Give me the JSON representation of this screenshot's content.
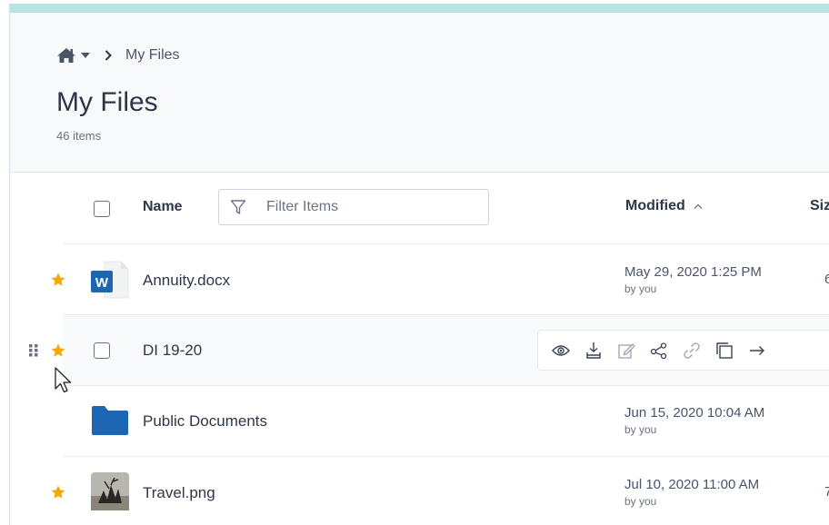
{
  "breadcrumb": {
    "current": "My Files"
  },
  "page": {
    "title": "My Files",
    "item_count": "46 items"
  },
  "columns": {
    "name": "Name",
    "filter_placeholder": "Filter Items",
    "modified": "Modified",
    "size": "Siz"
  },
  "rows": [
    {
      "name": "Annuity.docx",
      "modified": "May 29, 2020 1:25 PM",
      "by": "by you",
      "size": "6",
      "starred": true,
      "icon": "word-doc-icon"
    },
    {
      "name": "DI 19-20",
      "modified": "",
      "by": "",
      "size": "",
      "starred": true,
      "icon": "none"
    },
    {
      "name": "Public Documents",
      "modified": "Jun 15, 2020 10:04 AM",
      "by": "by you",
      "size": "",
      "starred": false,
      "icon": "folder-icon"
    },
    {
      "name": "Travel.png",
      "modified": "Jul 10, 2020 11:00 AM",
      "by": "by you",
      "size": "7",
      "starred": true,
      "icon": "image-thumbnail"
    }
  ],
  "row_actions": [
    "eye-icon",
    "download-icon",
    "edit-icon",
    "share-icon",
    "link-icon",
    "copy-icon",
    "move-arrow-icon"
  ],
  "colors": {
    "accent_blue": "#1d66b3",
    "star": "#f6a800",
    "top_strip": "#b7e3e1"
  }
}
